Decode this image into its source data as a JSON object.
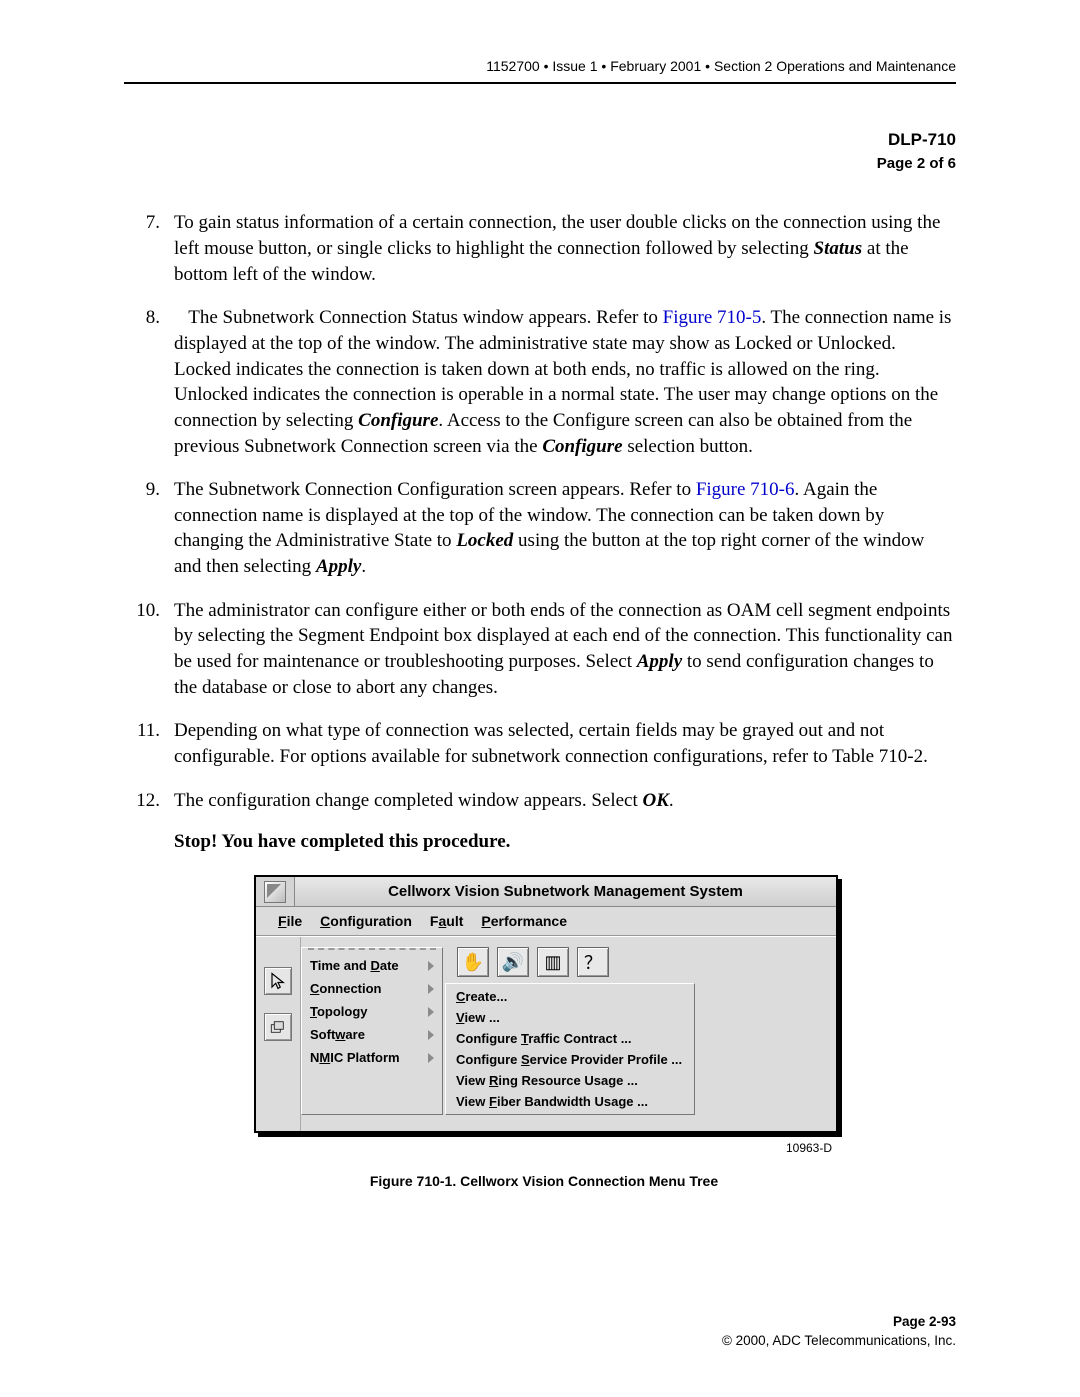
{
  "header": {
    "doc_no": "1152700",
    "issue": "Issue 1",
    "date": "February 2001",
    "section": "Section 2 Operations and Maintenance"
  },
  "dlp": {
    "title": "DLP-710",
    "page_of": "Page 2 of 6"
  },
  "steps": {
    "s7": {
      "num": "7.",
      "t1": "To gain status information of a certain connection, the user double clicks on the connection using the left mouse button, or single clicks to highlight the connection followed by selecting ",
      "b1": "Status",
      "t2": " at the bottom left of the window."
    },
    "s8": {
      "num": "8.",
      "t1": "The Subnetwork Connection Status window appears. Refer to ",
      "link1": "Figure 710-5",
      "t2": ". The connection name is displayed at the top of the window. The administrative state may show as Locked or Unlocked. Locked indicates the connection is taken down at both ends, no traffic is allowed on the ring. Unlocked indicates the connection is operable in a normal state. The user may change options on the connection by selecting ",
      "b1": "Configure",
      "t3": ". Access to the Configure screen can also be obtained from the previous Subnetwork Connection screen via the ",
      "b2": "Configure",
      "t4": " selection button."
    },
    "s9": {
      "num": "9.",
      "t1": "The Subnetwork Connection Configuration screen appears. Refer to ",
      "link1": "Figure 710-6",
      "t2": ". Again the connection name is displayed at the top of the window. The connection can be taken down by changing the Administrative State to ",
      "b1": "Locked",
      "t3": " using the button at the top right corner of the window and then selecting ",
      "b2": "Apply",
      "t4": "."
    },
    "s10": {
      "num": "10.",
      "t1": "The administrator can configure either or both ends of the connection as OAM cell segment endpoints by selecting the Segment Endpoint box displayed at each end of the connection. This functionality can be used for maintenance or troubleshooting purposes. Select ",
      "b1": "Apply",
      "t2": " to send configuration changes to the database or close to abort any changes."
    },
    "s11": {
      "num": "11.",
      "t1": "Depending on what type of connection was selected, certain fields may be grayed out and not configurable. For options available for subnetwork connection configurations, refer to Table 710-2."
    },
    "s12": {
      "num": "12.",
      "t1": "The configuration change completed window appears. Select ",
      "b1": "OK",
      "t2": "."
    }
  },
  "stop": "Stop! You have completed this procedure.",
  "window": {
    "title": "Cellworx Vision Subnetwork Management System",
    "menubar": {
      "file": "File",
      "config": "Configuration",
      "fault": "Fault",
      "perf": "Performance"
    },
    "config_menu": {
      "time_date": "Time and Date",
      "connection": "Connection",
      "topology": "Topology",
      "software": "Software",
      "nmic": "NMIC Platform"
    },
    "sub_menu": {
      "create": "Create...",
      "view": "View ...",
      "cfg_traffic": "Configure Traffic Contract ...",
      "cfg_service": "Configure Service Provider Profile ...",
      "view_ring": "View Ring Resource Usage ...",
      "view_fiber": "View Fiber Bandwidth Usage ..."
    },
    "figure_id": "10963-D",
    "caption": "Figure 710-1. Cellworx Vision Connection Menu Tree"
  },
  "footer": {
    "page": "Page 2-93",
    "copyright": "© 2000, ADC Telecommunications, Inc."
  }
}
